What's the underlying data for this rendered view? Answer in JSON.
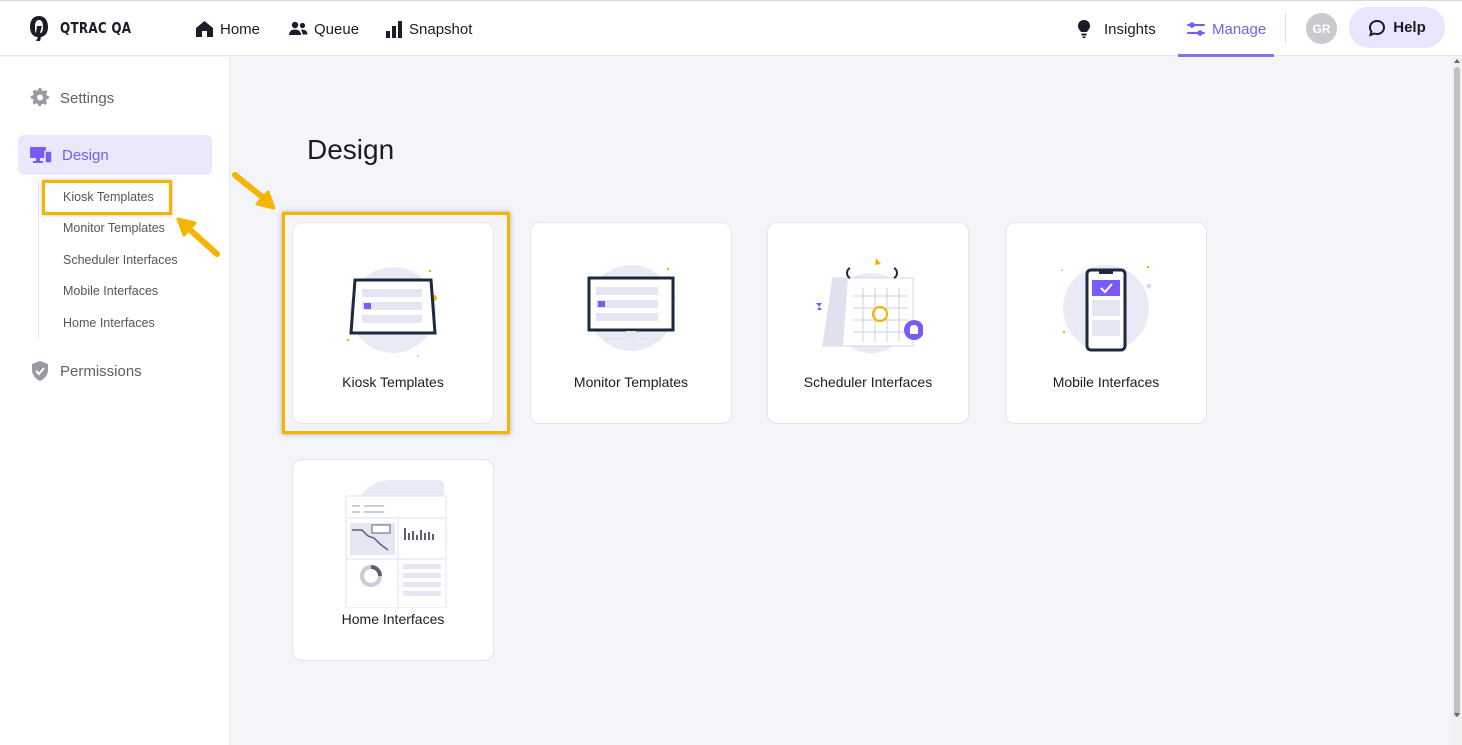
{
  "app": {
    "brand": "QTRAC QA"
  },
  "nav": {
    "home": "Home",
    "queue": "Queue",
    "snapshot": "Snapshot",
    "insights": "Insights",
    "manage": "Manage",
    "avatar_initials": "GR",
    "help": "Help"
  },
  "sidebar": {
    "settings": "Settings",
    "design": "Design",
    "permissions": "Permissions",
    "design_items": [
      "Kiosk Templates",
      "Monitor Templates",
      "Scheduler Interfaces",
      "Mobile Interfaces",
      "Home Interfaces"
    ]
  },
  "main": {
    "title": "Design",
    "cards": [
      "Kiosk Templates",
      "Monitor Templates",
      "Scheduler Interfaces",
      "Mobile Interfaces",
      "Home Interfaces"
    ]
  },
  "colors": {
    "accent": "#7a5af8",
    "highlight": "#f4b400",
    "active_bg": "#ece8fc"
  },
  "icons": {
    "logo": "q-logo-icon",
    "home": "home-icon",
    "queue": "people-icon",
    "snapshot": "bar-chart-icon",
    "insights": "lightbulb-icon",
    "manage": "sliders-icon",
    "help": "chat-bubble-icon",
    "settings": "gear-icon",
    "design": "devices-icon",
    "permissions": "shield-icon"
  }
}
